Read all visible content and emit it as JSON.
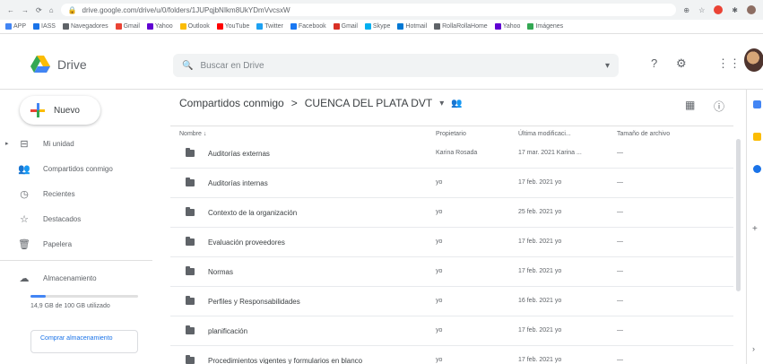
{
  "browser": {
    "url": "drive.google.com/drive/u/0/folders/1JUPqjbNIkm8UkYDmVvcsxW",
    "bookmarks": [
      {
        "label": "APP",
        "color": "#4285f4"
      },
      {
        "label": "IASS",
        "color": "#1a73e8"
      },
      {
        "label": "Navegadores",
        "color": "#5f6368"
      },
      {
        "label": "Gmail",
        "color": "#ea4335"
      },
      {
        "label": "Yahoo",
        "color": "#6001d2"
      },
      {
        "label": "Outlook",
        "color": "#fbbc04"
      },
      {
        "label": "YouTube",
        "color": "#ff0000"
      },
      {
        "label": "Twitter",
        "color": "#1da1f2"
      },
      {
        "label": "Facebook",
        "color": "#1877f2"
      },
      {
        "label": "Gmail",
        "color": "#d93025"
      },
      {
        "label": "Skype",
        "color": "#00aff0"
      },
      {
        "label": "Hotmail",
        "color": "#0078d4"
      },
      {
        "label": "RollaRollaHome",
        "color": "#5f6368"
      },
      {
        "label": "Yahoo",
        "color": "#6001d2"
      },
      {
        "label": "Imágenes",
        "color": "#34a853"
      }
    ]
  },
  "header": {
    "app_name": "Drive",
    "search_placeholder": "Buscar en Drive"
  },
  "sidebar": {
    "new_label": "Nuevo",
    "items": [
      {
        "label": "Mi unidad",
        "icon": "drive-icon"
      },
      {
        "label": "Compartidos conmigo",
        "icon": "people-icon"
      },
      {
        "label": "Recientes",
        "icon": "clock-icon"
      },
      {
        "label": "Destacados",
        "icon": "star-icon"
      },
      {
        "label": "Papelera",
        "icon": "trash-icon"
      }
    ],
    "storage_label": "Almacenamiento",
    "storage_used_fraction": 0.14,
    "storage_text": "14,9 GB de 100 GB utilizado",
    "buy_label": "Comprar almacenamiento"
  },
  "main": {
    "breadcrumb_root": "Compartidos conmigo",
    "breadcrumb_sep": ">",
    "breadcrumb_current": "CUENCA DEL PLATA DVT",
    "columns": {
      "name": "Nombre",
      "owner": "Propietario",
      "modified": "Última modificaci...",
      "size": "Tamaño de archivo"
    },
    "files": [
      {
        "name": "Auditorías externas",
        "owner": "Karina Rosada",
        "modified": "17 mar. 2021 Karina ...",
        "size": "—"
      },
      {
        "name": "Auditorías internas",
        "owner": "yo",
        "modified": "17 feb. 2021 yo",
        "size": "—"
      },
      {
        "name": "Contexto de la organización",
        "owner": "yo",
        "modified": "25 feb. 2021 yo",
        "size": "—"
      },
      {
        "name": "Evaluación proveedores",
        "owner": "yo",
        "modified": "17 feb. 2021 yo",
        "size": "—"
      },
      {
        "name": "Normas",
        "owner": "yo",
        "modified": "17 feb. 2021 yo",
        "size": "—"
      },
      {
        "name": "Perfiles y Responsabilidades",
        "owner": "yo",
        "modified": "16 feb. 2021 yo",
        "size": "—"
      },
      {
        "name": "planificación",
        "owner": "yo",
        "modified": "17 feb. 2021 yo",
        "size": "—"
      },
      {
        "name": "Procedimientos vigentes y formularios en blanco",
        "owner": "yo",
        "modified": "17 feb. 2021 yo",
        "size": "—"
      }
    ]
  },
  "colors": {
    "accent": "#1a73e8",
    "folder": "#5f6368"
  }
}
